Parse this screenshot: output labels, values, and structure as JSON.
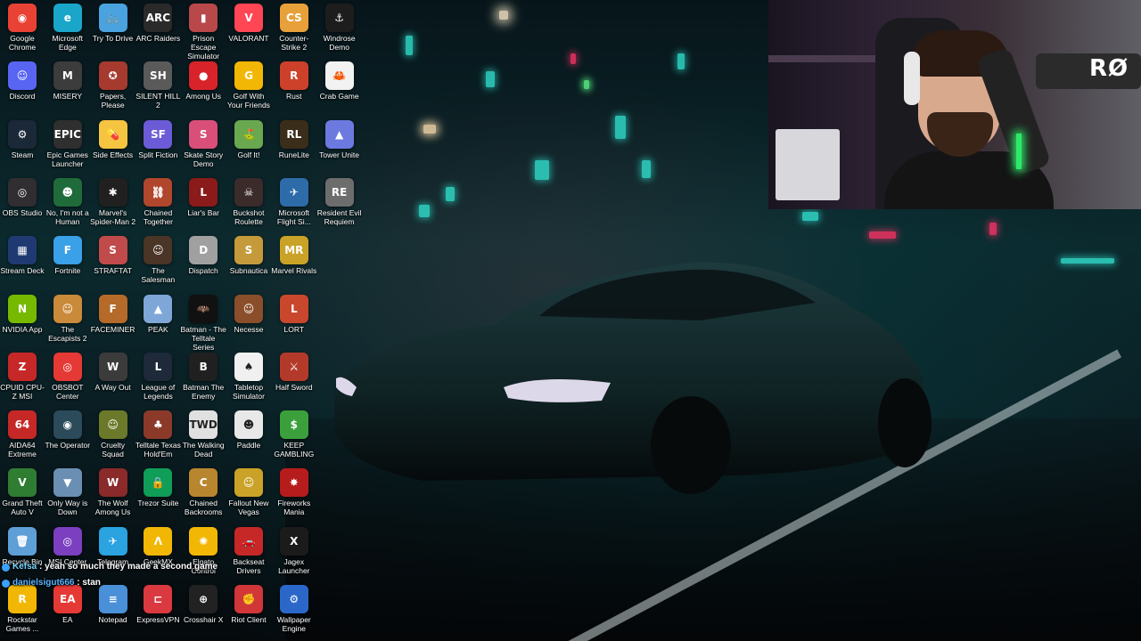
{
  "desktop_icons": [
    {
      "label": "Google Chrome",
      "color": "#e94235",
      "glyph": "◉"
    },
    {
      "label": "Microsoft Edge",
      "color": "#1aa6c9",
      "glyph": "e"
    },
    {
      "label": "Try To Drive",
      "color": "#4aa3df",
      "glyph": "🚲"
    },
    {
      "label": "ARC Raiders",
      "color": "#2a2a2a",
      "glyph": "ARC"
    },
    {
      "label": "Prison Escape Simulator",
      "color": "#b9484a",
      "glyph": "▮"
    },
    {
      "label": "VALORANT",
      "color": "#ff4655",
      "glyph": "V"
    },
    {
      "label": "Counter-Strike 2",
      "color": "#e8a03a",
      "glyph": "CS"
    },
    {
      "label": "Windrose Demo",
      "color": "#1d1d1d",
      "glyph": "⚓"
    },
    {
      "label": "Discord",
      "color": "#5865f2",
      "glyph": "☺"
    },
    {
      "label": "MISERY",
      "color": "#3c3c3c",
      "glyph": "M"
    },
    {
      "label": "Papers, Please",
      "color": "#a63a2f",
      "glyph": "✪"
    },
    {
      "label": "SILENT HILL 2",
      "color": "#5a5a5a",
      "glyph": "SH"
    },
    {
      "label": "Among Us",
      "color": "#d8232a",
      "glyph": "●"
    },
    {
      "label": "Golf With Your Friends",
      "color": "#f2b705",
      "glyph": "G"
    },
    {
      "label": "Rust",
      "color": "#cd412b",
      "glyph": "R"
    },
    {
      "label": "Crab Game",
      "color": "#f2f2f2",
      "glyph": "🦀"
    },
    {
      "label": "Steam",
      "color": "#1b2838",
      "glyph": "⚙"
    },
    {
      "label": "Epic Games Launcher",
      "color": "#2f2f2f",
      "glyph": "EPIC"
    },
    {
      "label": "Side Effects",
      "color": "#f5c542",
      "glyph": "💊"
    },
    {
      "label": "Split Fiction",
      "color": "#6c5bd6",
      "glyph": "SF"
    },
    {
      "label": "Skate Story Demo",
      "color": "#d94f7a",
      "glyph": "S"
    },
    {
      "label": "Golf It!",
      "color": "#6aa84f",
      "glyph": "⛳"
    },
    {
      "label": "RuneLite",
      "color": "#3a2d1a",
      "glyph": "RL"
    },
    {
      "label": "Tower Unite",
      "color": "#6c7ae0",
      "glyph": "▲"
    },
    {
      "label": "OBS Studio",
      "color": "#302e31",
      "glyph": "◎"
    },
    {
      "label": "No, I'm not a Human",
      "color": "#1f6b3a",
      "glyph": "☻"
    },
    {
      "label": "Marvel's Spider-Man 2",
      "color": "#202020",
      "glyph": "✱"
    },
    {
      "label": "Chained Together",
      "color": "#b0462c",
      "glyph": "⛓"
    },
    {
      "label": "Liar's Bar",
      "color": "#8b1a1a",
      "glyph": "L"
    },
    {
      "label": "Buckshot Roulette",
      "color": "#3b2b2b",
      "glyph": "☠"
    },
    {
      "label": "Microsoft Flight Si...",
      "color": "#2d6ca8",
      "glyph": "✈"
    },
    {
      "label": "Resident Evil Requiem",
      "color": "#6d6d6d",
      "glyph": "RE"
    },
    {
      "label": "Stream Deck",
      "color": "#1f3a73",
      "glyph": "▦"
    },
    {
      "label": "Fortnite",
      "color": "#3aa0e8",
      "glyph": "F"
    },
    {
      "label": "STRAFTAT",
      "color": "#c14b4b",
      "glyph": "S"
    },
    {
      "label": "The Salesman",
      "color": "#4a3526",
      "glyph": "☺"
    },
    {
      "label": "Dispatch",
      "color": "#a0a0a0",
      "glyph": "D"
    },
    {
      "label": "Subnautica",
      "color": "#c59a3b",
      "glyph": "S"
    },
    {
      "label": "Marvel Rivals",
      "color": "#c9a227",
      "glyph": "MR"
    },
    {
      "label": "",
      "color": "transparent",
      "glyph": ""
    },
    {
      "label": "NVIDIA App",
      "color": "#76b900",
      "glyph": "N"
    },
    {
      "label": "The Escapists 2",
      "color": "#c98a3a",
      "glyph": "☺"
    },
    {
      "label": "FACEMINER",
      "color": "#b56a2a",
      "glyph": "F"
    },
    {
      "label": "PEAK",
      "color": "#7ea7d8",
      "glyph": "▲"
    },
    {
      "label": "Batman - The Telltale Series",
      "color": "#111111",
      "glyph": "🦇"
    },
    {
      "label": "Necesse",
      "color": "#8a4f2a",
      "glyph": "☺"
    },
    {
      "label": "LORT",
      "color": "#c9472d",
      "glyph": "L"
    },
    {
      "label": "",
      "color": "transparent",
      "glyph": ""
    },
    {
      "label": "CPUID CPU-Z MSI",
      "color": "#c62828",
      "glyph": "Z"
    },
    {
      "label": "OBSBOT Center",
      "color": "#e53935",
      "glyph": "◎"
    },
    {
      "label": "A Way Out",
      "color": "#3b3b3b",
      "glyph": "W"
    },
    {
      "label": "League of Legends",
      "color": "#1e2a3a",
      "glyph": "L"
    },
    {
      "label": "Batman The Enemy",
      "color": "#202020",
      "glyph": "B"
    },
    {
      "label": "Tabletop Simulator",
      "color": "#f0f0f0",
      "glyph": "♠"
    },
    {
      "label": "Half Sword",
      "color": "#b33a2a",
      "glyph": "⚔"
    },
    {
      "label": "",
      "color": "transparent",
      "glyph": ""
    },
    {
      "label": "AIDA64 Extreme",
      "color": "#c62828",
      "glyph": "64"
    },
    {
      "label": "The Operator",
      "color": "#2b4a5a",
      "glyph": "◉"
    },
    {
      "label": "Cruelty Squad",
      "color": "#6b7a2a",
      "glyph": "☺"
    },
    {
      "label": "Telltale Texas Hold'Em",
      "color": "#8b3a2a",
      "glyph": "♣"
    },
    {
      "label": "The Walking Dead",
      "color": "#e0e0e0",
      "glyph": "TWD"
    },
    {
      "label": "Paddle",
      "color": "#e8e8e8",
      "glyph": "☻"
    },
    {
      "label": "KEEP GAMBLING",
      "color": "#3ba03b",
      "glyph": "$"
    },
    {
      "label": "",
      "color": "transparent",
      "glyph": ""
    },
    {
      "label": "Grand Theft Auto V",
      "color": "#2e7d32",
      "glyph": "V"
    },
    {
      "label": "Only Way is Down",
      "color": "#6a8fb3",
      "glyph": "▼"
    },
    {
      "label": "The Wolf Among Us",
      "color": "#8b2a2a",
      "glyph": "W"
    },
    {
      "label": "Trezor Suite",
      "color": "#0f9d58",
      "glyph": "🔒"
    },
    {
      "label": "Chained Backrooms",
      "color": "#b8862e",
      "glyph": "C"
    },
    {
      "label": "Fallout New Vegas",
      "color": "#c9a227",
      "glyph": "☺"
    },
    {
      "label": "Fireworks Mania",
      "color": "#b71c1c",
      "glyph": "✸"
    },
    {
      "label": "",
      "color": "transparent",
      "glyph": ""
    },
    {
      "label": "Recycle Bin",
      "color": "#5e9fd8",
      "glyph": "🗑"
    },
    {
      "label": "MSI Center",
      "color": "#7b3fbf",
      "glyph": "◎"
    },
    {
      "label": "Telegram",
      "color": "#2aa3e0",
      "glyph": "✈"
    },
    {
      "label": "GeekMX",
      "color": "#f2b705",
      "glyph": "Λ"
    },
    {
      "label": "Elgato Control",
      "color": "#f2b705",
      "glyph": "✺"
    },
    {
      "label": "Backseat Drivers",
      "color": "#c62828",
      "glyph": "🚗"
    },
    {
      "label": "Jagex Launcher",
      "color": "#1b1b1b",
      "glyph": "X"
    },
    {
      "label": "",
      "color": "transparent",
      "glyph": ""
    },
    {
      "label": "Rockstar Games ...",
      "color": "#f2b705",
      "glyph": "R"
    },
    {
      "label": "EA",
      "color": "#e53935",
      "glyph": "EA"
    },
    {
      "label": "Notepad",
      "color": "#4a90d9",
      "glyph": "≡"
    },
    {
      "label": "ExpressVPN",
      "color": "#da3940",
      "glyph": "⊏"
    },
    {
      "label": "Crosshair X",
      "color": "#222222",
      "glyph": "⊕"
    },
    {
      "label": "Riot Client",
      "color": "#d13639",
      "glyph": "✊"
    },
    {
      "label": "Wallpaper Engine",
      "color": "#2b67c9",
      "glyph": "⚙"
    },
    {
      "label": "",
      "color": "transparent",
      "glyph": ""
    }
  ],
  "chat": [
    {
      "user": "Kefsa",
      "message": " : yeah so much they made a second game",
      "user_class": "user-b"
    },
    {
      "user": "danielsigut666",
      "message": " : stan",
      "user_class": "user-a"
    }
  ],
  "webcam": {
    "brand_text": "RØ"
  }
}
